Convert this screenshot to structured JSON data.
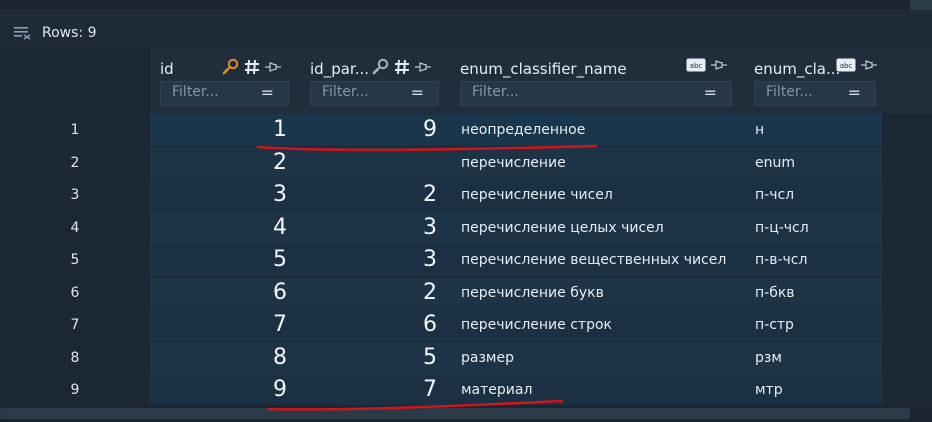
{
  "toolbar": {
    "rows_label": "Rows: 9",
    "icon": "filter-rows-icon"
  },
  "columns": [
    {
      "title": "id",
      "filter_placeholder": "Filter...",
      "icons": [
        "key-icon",
        "hash-icon",
        "pin-icon"
      ]
    },
    {
      "title": "id_par...",
      "filter_placeholder": "Filter...",
      "icons": [
        "key-icon",
        "hash-icon",
        "pin-icon"
      ]
    },
    {
      "title": "enum_classifier_name",
      "filter_placeholder": "Filter...",
      "icons": [
        "abc-icon",
        "pin-icon"
      ]
    },
    {
      "title": "enum_cla...",
      "filter_placeholder": "Filter...",
      "icons": [
        "abc-icon",
        "pin-icon"
      ]
    }
  ],
  "filter_menu_icon": "equals-icon",
  "rows": [
    {
      "num": "1",
      "id": "1",
      "pid": "9",
      "name": "неопределенное",
      "code": "н"
    },
    {
      "num": "2",
      "id": "2",
      "pid": "",
      "name": "перечисление",
      "code": "enum"
    },
    {
      "num": "3",
      "id": "3",
      "pid": "2",
      "name": "перечисление чисел",
      "code": "п-чсл"
    },
    {
      "num": "4",
      "id": "4",
      "pid": "3",
      "name": "перечисление целых чисел",
      "code": "п-ц-чсл"
    },
    {
      "num": "5",
      "id": "5",
      "pid": "3",
      "name": "перечисление вещественных чисел",
      "code": "п-в-чсл"
    },
    {
      "num": "6",
      "id": "6",
      "pid": "2",
      "name": "перечисление букв",
      "code": "п-бкв"
    },
    {
      "num": "7",
      "id": "7",
      "pid": "6",
      "name": "перечисление строк",
      "code": "п-стр"
    },
    {
      "num": "8",
      "id": "8",
      "pid": "5",
      "name": "размер",
      "code": "рзм"
    },
    {
      "num": "9",
      "id": "9",
      "pid": "7",
      "name": "материал",
      "code": "мтр"
    }
  ],
  "colors": {
    "annotation": "#d0161b",
    "key_icon": "#e0902a",
    "background": "#1e2b36"
  }
}
